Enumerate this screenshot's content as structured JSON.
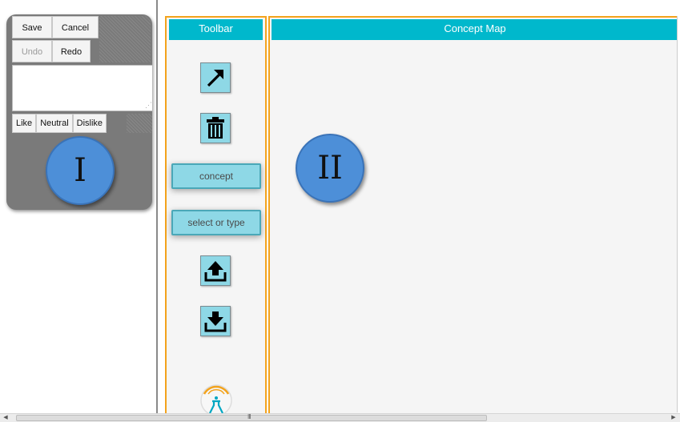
{
  "left_panel": {
    "save_label": "Save",
    "cancel_label": "Cancel",
    "undo_label": "Undo",
    "redo_label": "Redo",
    "comment_value": "",
    "rating": [
      "Like",
      "Neutral",
      "Dislike"
    ],
    "marker": "I"
  },
  "toolbar": {
    "title": "Toolbar",
    "tools": [
      {
        "icon": "arrow-link-icon"
      },
      {
        "icon": "trash-icon"
      },
      {
        "label": "concept"
      },
      {
        "label": "select or type"
      },
      {
        "icon": "upload-icon"
      },
      {
        "icon": "download-icon"
      }
    ],
    "logo_icon": "flask-logo-icon"
  },
  "concept_map": {
    "title": "Concept Map",
    "marker": "II"
  },
  "scrollbar": {
    "grip": "III"
  },
  "colors": {
    "header": "#00b8cc",
    "panel_border": "#f3a31c",
    "tool_fill": "#8ed8e6",
    "marker_fill": "#4d8fd8"
  }
}
